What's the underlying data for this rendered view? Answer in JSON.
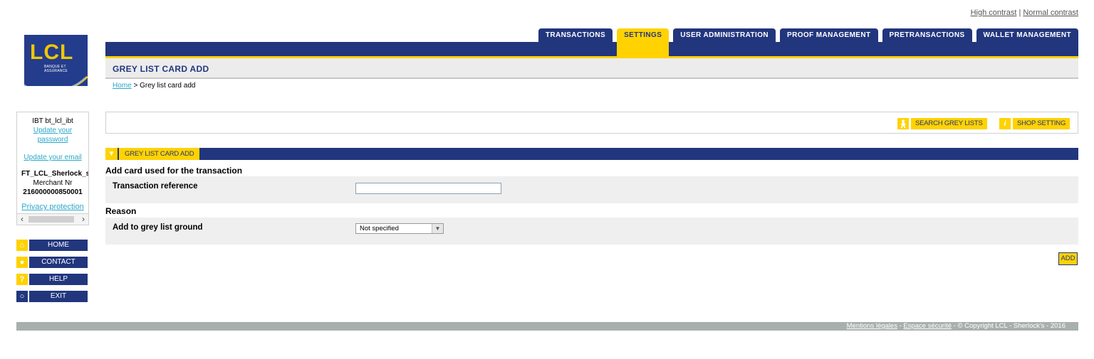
{
  "contrast": {
    "high": "High contrast",
    "separator": "|",
    "normal": "Normal contrast"
  },
  "logo": {
    "text": "LCL",
    "tagline": "BANQUE ET ASSURANCE"
  },
  "tabs": [
    {
      "label": "TRANSACTIONS",
      "active": false
    },
    {
      "label": "SETTINGS",
      "active": true
    },
    {
      "label": "USER ADMINISTRATION",
      "active": false
    },
    {
      "label": "PROOF MANAGEMENT",
      "active": false
    },
    {
      "label": "PRETRANSACTIONS",
      "active": false
    },
    {
      "label": "WALLET MANAGEMENT",
      "active": false
    }
  ],
  "page": {
    "title": "GREY LIST CARD ADD"
  },
  "breadcrumb": {
    "home": "Home",
    "separator": " > ",
    "current": "Grey list card add"
  },
  "user": {
    "name": "IBT bt_lcl_ibt",
    "update_password": "Update your password",
    "update_email": "Update your email",
    "shop": "FT_LCL_Sherlock_s",
    "merchant_label": "Merchant Nr",
    "merchant_nr": "216000000850001",
    "privacy": "Privacy protection"
  },
  "sidenav": [
    {
      "label": "HOME",
      "icon": "home-icon"
    },
    {
      "label": "CONTACT",
      "icon": "speech-bubble-icon"
    },
    {
      "label": "HELP",
      "icon": "question-icon"
    },
    {
      "label": "EXIT",
      "icon": "exit-icon"
    }
  ],
  "actions": {
    "search": "SEARCH GREY LISTS",
    "shop": "SHOP SETTING"
  },
  "section": {
    "tab": "GREY LIST CARD ADD"
  },
  "form": {
    "card_title": "Add card used for the transaction",
    "transaction_reference_label": "Transaction reference",
    "transaction_reference_value": "",
    "reason_title": "Reason",
    "ground_label": "Add to grey list ground",
    "ground_selected": "Not specified",
    "add_button": "ADD"
  },
  "footer": {
    "legal": "Mentions légales",
    "security": "Espace sécurité",
    "copyright": " - © Copyright LCL - Sherlock's - 2016"
  },
  "colors": {
    "brand_blue": "#22367e",
    "brand_yellow": "#ffd200",
    "link": "#2aa8c8"
  }
}
